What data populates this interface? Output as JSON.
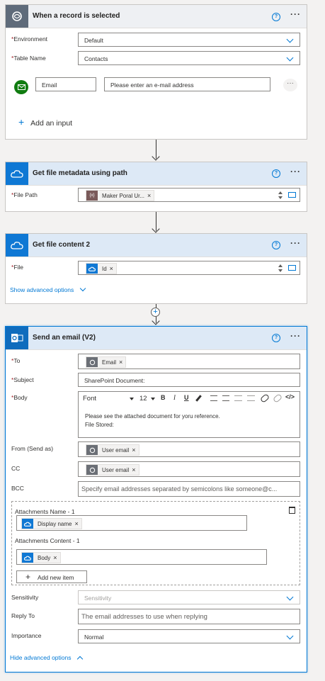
{
  "trigger": {
    "title": "When a record is selected",
    "environment_label": "Environment",
    "environment_value": "Default",
    "table_label": "Table Name",
    "table_value": "Contacts",
    "input_name": "Email",
    "input_placeholder": "Please enter an e-mail address",
    "add_input": "Add an input"
  },
  "step1": {
    "title": "Get file metadata using path",
    "file_path_label": "File Path",
    "token": "Maker Poral Ur..."
  },
  "step2": {
    "title": "Get file content 2",
    "file_label": "File",
    "token": "Id",
    "advanced": "Show advanced options"
  },
  "step3": {
    "title": "Send an email (V2)",
    "to_label": "To",
    "to_token": "Email",
    "subject_label": "Subject",
    "subject_value": "SharePoint Document:",
    "body_label": "Body",
    "font": "Font",
    "font_size": "12",
    "body_line1": "Please see the attached document for yoru reference.",
    "body_line2": "File Stored:",
    "from_label": "From (Send as)",
    "from_token": "User email",
    "cc_label": "CC",
    "cc_token": "User email",
    "bcc_label": "BCC",
    "bcc_placeholder": "Specify email addresses separated by semicolons like someone@c...",
    "att_name_label": "Attachments Name - 1",
    "att_name_token": "Display name",
    "att_content_label": "Attachments Content - 1",
    "att_content_token": "Body",
    "add_item": "Add new item",
    "sensitivity_label": "Sensitivity",
    "sensitivity_placeholder": "Sensitivity",
    "reply_label": "Reply To",
    "reply_placeholder": "The email addresses to use when replying",
    "importance_label": "Importance",
    "importance_value": "Normal",
    "hide_advanced": "Hide advanced options"
  },
  "colors": {
    "accent": "#0078d4",
    "required": "#a4262c",
    "outlook": "#0f6cbd"
  }
}
